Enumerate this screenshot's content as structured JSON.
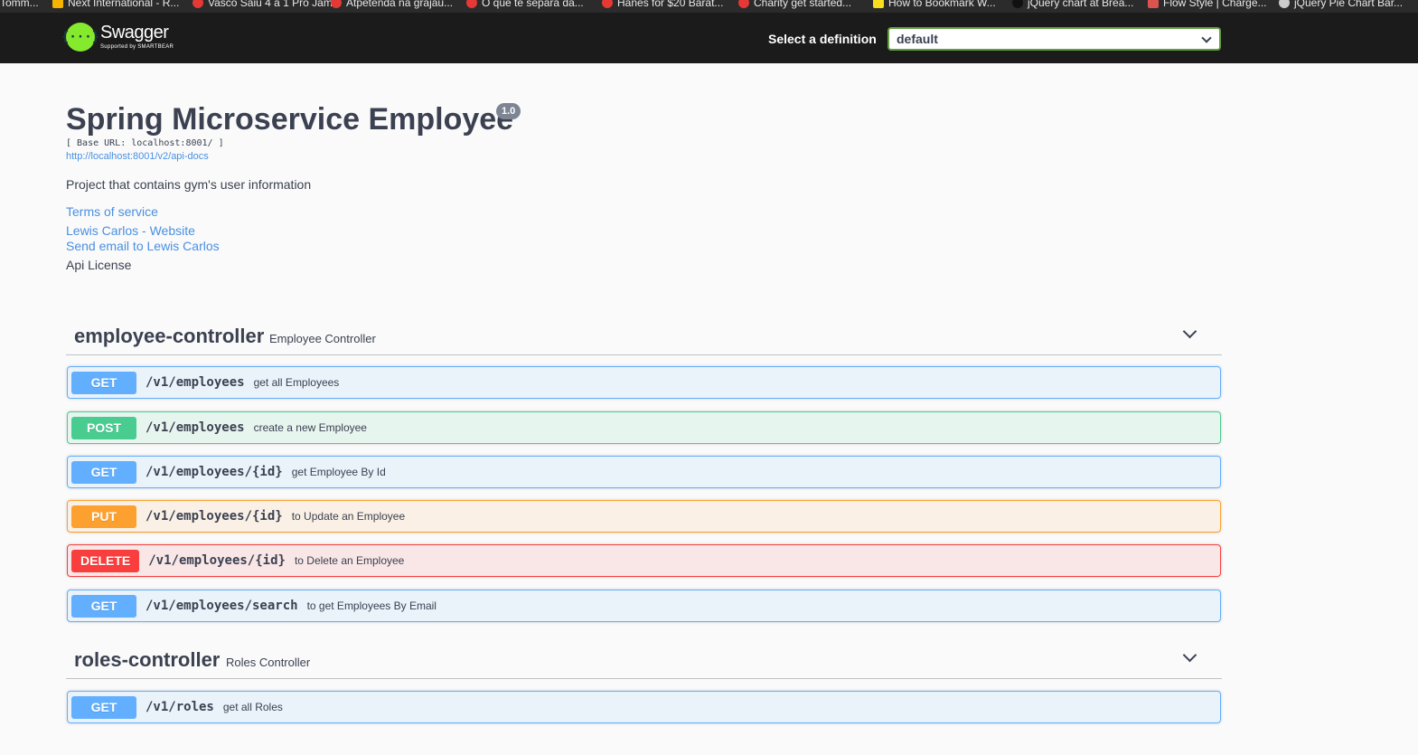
{
  "bookmarks": [
    {
      "label": "Tomm..."
    },
    {
      "label": "Next International - R..."
    },
    {
      "label": "Vasco Saiu 4 a 1 Pro Jam..."
    },
    {
      "label": "Atpetenda na grajaú..."
    },
    {
      "label": "O que te separa da..."
    },
    {
      "label": "Hanes for $20 Barat..."
    },
    {
      "label": "Charity get started..."
    },
    {
      "label": "How to Bookmark W..."
    },
    {
      "label": "jQuery chart at Brea..."
    },
    {
      "label": "Flow Style | Charge..."
    },
    {
      "label": "jQuery Pie Chart Bar..."
    }
  ],
  "topbar": {
    "logo_symbol": "{···}",
    "logo_name": "Swagger",
    "logo_sub": "Supported by SMARTBEAR",
    "definition_label": "Select a definition",
    "definition_value": "default"
  },
  "info": {
    "title": "Spring Microservice Employee",
    "version": "1.0",
    "base_url": "[ Base URL: localhost:8001/ ]",
    "spec_link": "http://localhost:8001/v2/api-docs",
    "description": "Project that contains gym's user information",
    "terms": "Terms of service",
    "contact_site": "Lewis Carlos - Website",
    "contact_email": "Send email to Lewis Carlos",
    "license": "Api License"
  },
  "controllers": [
    {
      "name": "employee-controller",
      "description": "Employee Controller",
      "operations": [
        {
          "method": "GET",
          "path": "/v1/employees",
          "summary": "get all Employees"
        },
        {
          "method": "POST",
          "path": "/v1/employees",
          "summary": "create a new Employee"
        },
        {
          "method": "GET",
          "path": "/v1/employees/{id}",
          "summary": "get Employee By Id"
        },
        {
          "method": "PUT",
          "path": "/v1/employees/{id}",
          "summary": "to Update an Employee"
        },
        {
          "method": "DELETE",
          "path": "/v1/employees/{id}",
          "summary": "to Delete an Employee"
        },
        {
          "method": "GET",
          "path": "/v1/employees/search",
          "summary": "to get Employees By Email"
        }
      ]
    },
    {
      "name": "roles-controller",
      "description": "Roles Controller",
      "operations": [
        {
          "method": "GET",
          "path": "/v1/roles",
          "summary": "get all Roles"
        }
      ]
    }
  ],
  "colors": {
    "get": "#61affe",
    "post": "#49cc90",
    "put": "#fca130",
    "delete": "#f93e3e",
    "swagger_green": "#85ea2d"
  }
}
